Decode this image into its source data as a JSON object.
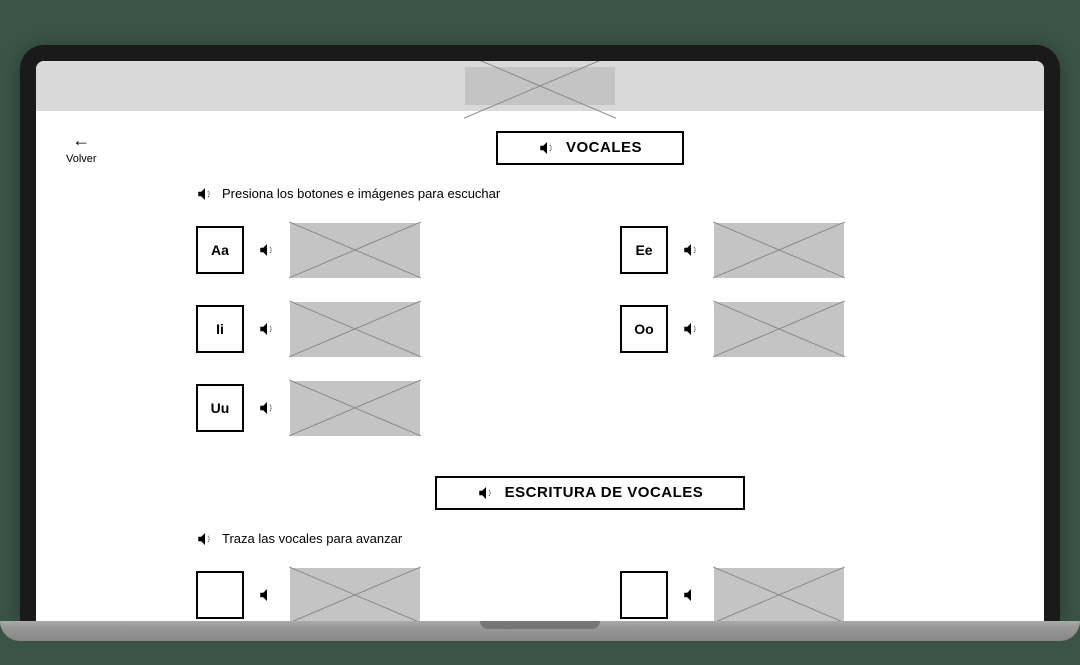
{
  "nav": {
    "back_label": "Volver"
  },
  "sections": {
    "vocales": {
      "title": "VOCALES",
      "instruction": "Presiona los botones e imágenes para escuchar"
    },
    "escritura": {
      "title": "ESCRITURA DE VOCALES",
      "instruction": "Traza las vocales para avanzar"
    }
  },
  "vowels": [
    {
      "label": "Aa"
    },
    {
      "label": "Ee"
    },
    {
      "label": "Ii"
    },
    {
      "label": "Oo"
    },
    {
      "label": "Uu"
    }
  ]
}
